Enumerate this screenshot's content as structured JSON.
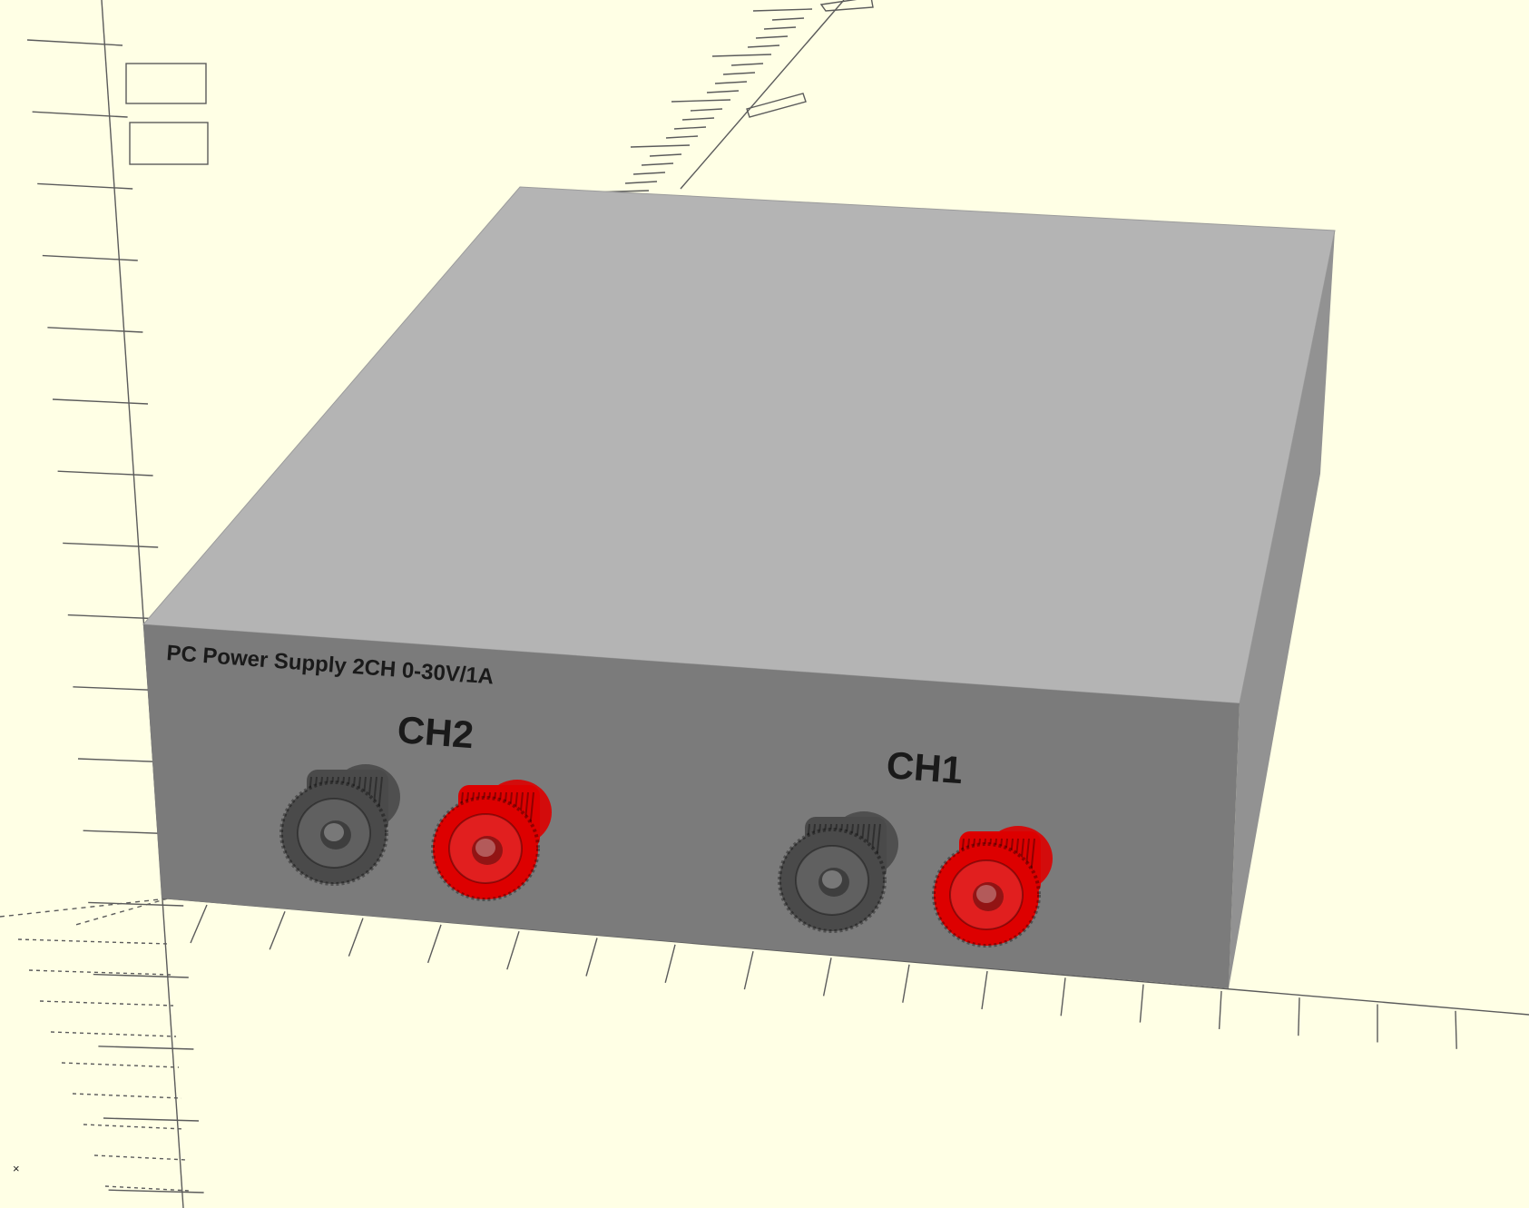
{
  "viewport": {
    "background": "#ffffe5",
    "grid_color": "#5b5b5b",
    "origin_marker": "×"
  },
  "model": {
    "title_text": "PC Power Supply 2CH 0-30V/1A",
    "channel_labels": [
      "CH2",
      "CH1"
    ],
    "colors": {
      "top": "#b4b4b4",
      "front": "#7b7b7b",
      "right": "#929292",
      "terminal_black": "#4a4a4a",
      "terminal_red": "#dd0000"
    }
  },
  "terminals": [
    {
      "name": "ch2-black-terminal",
      "color": "terminal_black"
    },
    {
      "name": "ch2-red-terminal",
      "color": "terminal_red"
    },
    {
      "name": "ch1-black-terminal",
      "color": "terminal_black"
    },
    {
      "name": "ch1-red-terminal",
      "color": "terminal_red"
    }
  ]
}
